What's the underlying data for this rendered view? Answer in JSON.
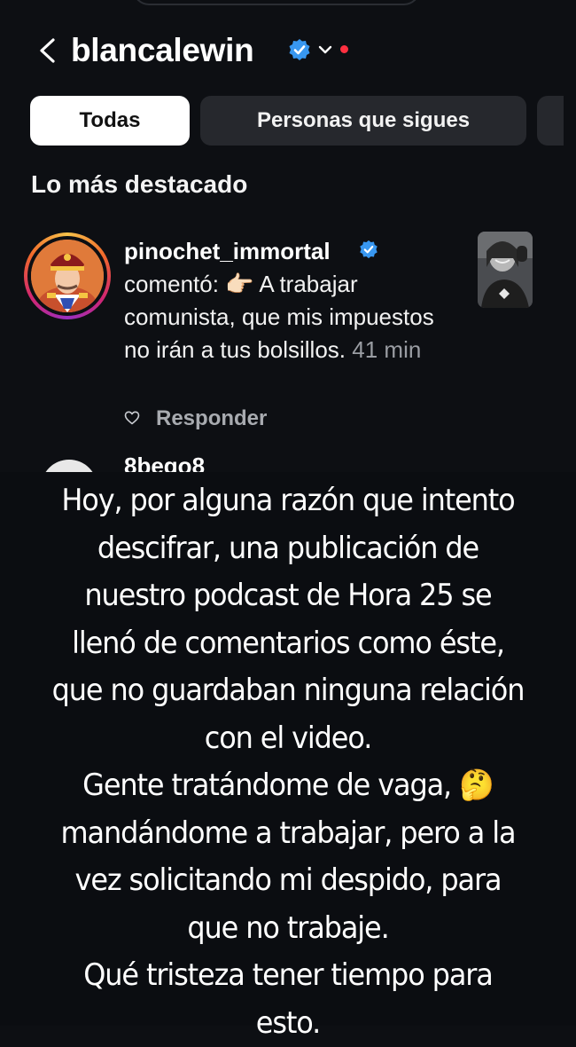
{
  "header": {
    "username": "blancalewin"
  },
  "tabs": [
    {
      "label": "Todas",
      "active": true
    },
    {
      "label": "Personas que sigues",
      "active": false
    }
  ],
  "section": {
    "title": "Lo más destacado"
  },
  "comment": {
    "user": "pinochet_immortal",
    "text": "comentó: 👉🏻 A trabajar comunista, que mis impuestos no irán a tus bolsillos.",
    "time": "41 min",
    "reply_label": "Responder"
  },
  "next_comment": {
    "user": "8bego8"
  },
  "caption": {
    "line1": "Hoy, por alguna razón que intento descifrar, una publicación de nuestro podcast de Hora 25 se llenó de comentarios como éste, que no guardaban ninguna relación con el video.",
    "line2": "Gente tratándome de vaga, 🤔 mandándome a trabajar, pero a la vez solicitando mi despido, para que no trabaje.",
    "line3": "Qué tristeza tener tiempo para esto."
  },
  "colors": {
    "background": "#0d0f13",
    "verified": "#3897f0",
    "notification_dot": "#ff3040",
    "tab_inactive": "#26282d"
  },
  "icons": [
    "back-icon",
    "verified-icon",
    "chevron-down-icon",
    "heart-icon"
  ]
}
